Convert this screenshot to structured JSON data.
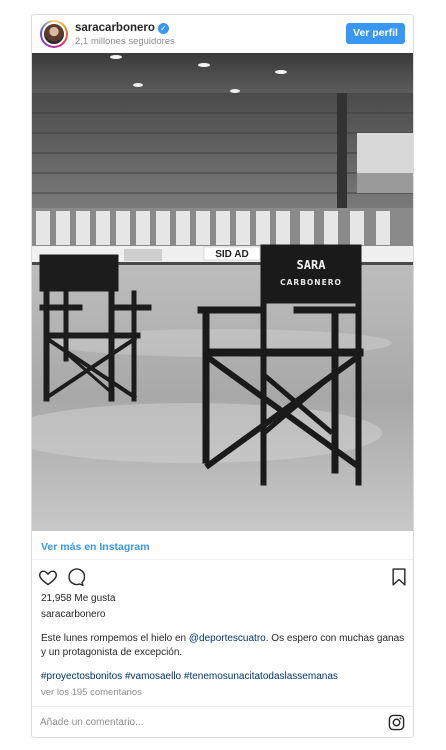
{
  "post": {
    "username": "saracarbonero",
    "followers": "2,1 millones seguidores",
    "profile_button": "Ver perfil",
    "photo": {
      "chair_back_line1": "SARA",
      "chair_back_line2": "CARBONERO",
      "sign_text": "SID AD"
    },
    "see_more": "Ver más en Instagram",
    "likes": "21,958 Me gusta",
    "owner": "saracarbonero",
    "caption_before": "Este lunes rompemos el hielo en ",
    "caption_mention": "@deportescuatro",
    "caption_after": ". Os espero con muchas ganas y un protagonista de excepción.",
    "hashtags": [
      "#proyectosbonitos",
      "#vamosaello",
      "#tenemosunacitatodaslassemanas"
    ],
    "comments_link": "ver los 195 comentarios",
    "comment_placeholder": "Añade un comentario..."
  },
  "icons": {
    "verified": "verified-badge-icon",
    "like": "heart-icon",
    "comment": "comment-bubble-icon",
    "save": "bookmark-icon",
    "instagram": "instagram-logo-icon"
  },
  "colors": {
    "accent": "#3897f0",
    "mention": "#003569",
    "muted": "#8e8e8e",
    "border": "#dbdbdb"
  }
}
